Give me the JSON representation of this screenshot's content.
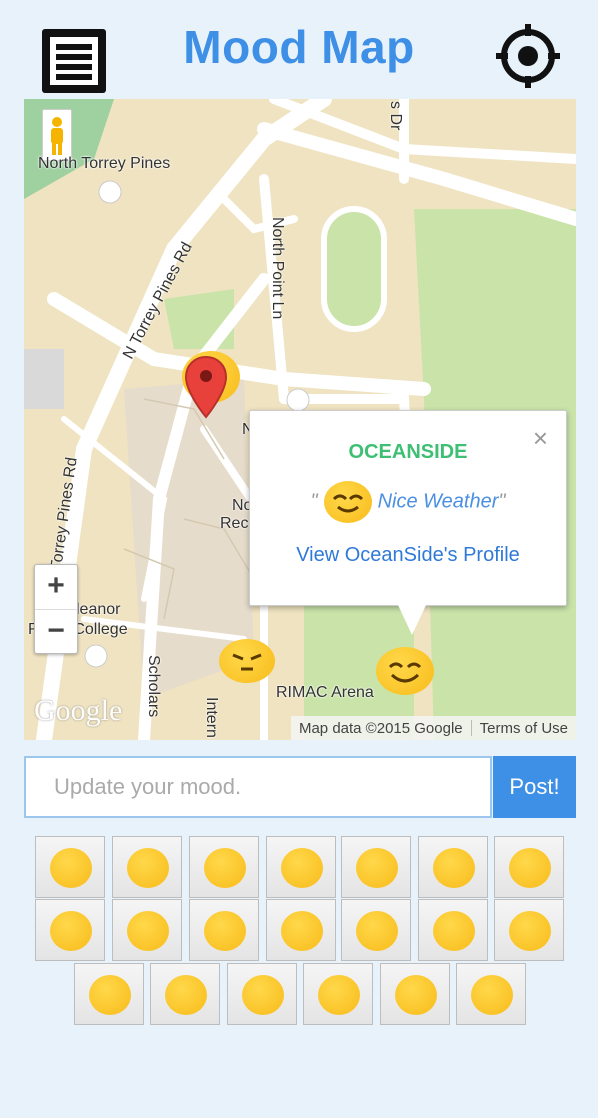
{
  "header": {
    "title": "Mood Map",
    "menu_icon": "hamburger-menu-icon",
    "locate_icon": "crosshair-locate-icon",
    "accent_color": "#3e8fe6"
  },
  "map": {
    "labels": {
      "north_torrey_pines": "North Torrey Pines",
      "n_torrey_pines_rd": "N Torrey Pines Rd",
      "torrey_pines_rd": "Torrey Pines Rd",
      "north_point_ln": "North Point Ln",
      "dr": "s Dr",
      "n": "N",
      "no_rec": "No",
      "rec": "Rec",
      "eleanor": "leanor",
      "roosevelt": "R      velt College",
      "scholars": "Scholars",
      "intern": "Intern",
      "rimac": "RIMAC Arena"
    },
    "google_logo": "Google",
    "attribution": "Map data ©2015 Google",
    "terms": "Terms of Use",
    "zoom_in": "+",
    "zoom_out": "−",
    "info_window": {
      "username": "OCEANSIDE",
      "open_quote": "\"",
      "mood_text": "Nice Weather",
      "close_quote": "\"",
      "profile_link": "View OceanSide's Profile",
      "close": "×",
      "user_color": "#3fbf73"
    },
    "markers": [
      {
        "icon": "smiling-blush-emoji-icon"
      },
      {
        "icon": "pouting-emoji-icon"
      },
      {
        "icon": "heart-eyes-emoji-icon"
      },
      {
        "icon": "red-map-pin-icon"
      }
    ]
  },
  "mood_input": {
    "placeholder": "Update your mood.",
    "value": ""
  },
  "post_button": {
    "label": "Post!"
  },
  "emoji_palette": {
    "rows": [
      [
        "smiling-emoji-icon",
        "kissing-blush-emoji-icon",
        "winking-kiss-emoji-icon",
        "heart-eyes-emoji-icon",
        "relieved-emoji-icon",
        "grinning-sweat-emoji-icon",
        "smirking-emoji-icon"
      ],
      [
        "sunglasses-emoji-icon",
        "grinning-teeth-emoji-icon",
        "waving-emoji-icon",
        "surprised-emoji-icon",
        "frowning-emoji-icon",
        "pensive-emoji-icon",
        "confounded-emoji-icon"
      ],
      [
        "praying-emoji-icon",
        "grimacing-emoji-icon",
        "pouting-emoji-icon",
        "unamused-emoji-icon",
        "angry-emoji-icon",
        "crying-loud-emoji-icon"
      ]
    ]
  }
}
